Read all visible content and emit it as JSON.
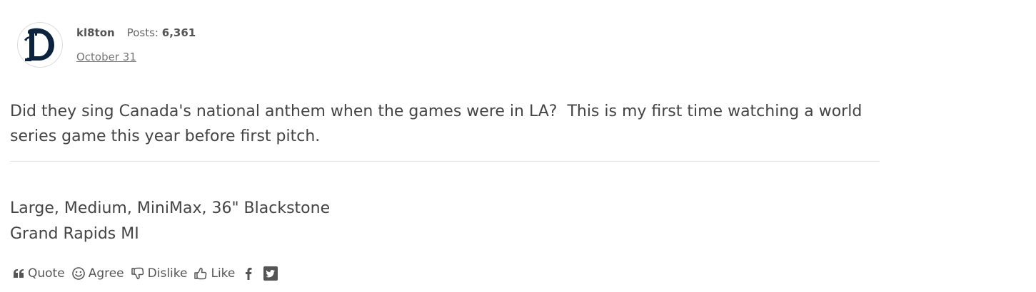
{
  "post": {
    "author": {
      "username": "kl8ton",
      "posts_label": "Posts:",
      "posts_count": "6,361",
      "avatar_icon": "detroit-tigers-d-icon"
    },
    "date": "October 31",
    "message": "Did they sing Canada's national anthem when the games were in LA?  This is my first time watching a world series game this year before first pitch.",
    "signature": {
      "line1": "Large, Medium, MiniMax, 36\" Blackstone",
      "line2": "Grand Rapids MI"
    },
    "reactions": [
      {
        "label": "Quote",
        "icon": "quote-icon"
      },
      {
        "label": "Agree",
        "icon": "smile-icon"
      },
      {
        "label": "Dislike",
        "icon": "thumbs-down-icon"
      },
      {
        "label": "Like",
        "icon": "thumbs-up-icon"
      }
    ],
    "share": [
      {
        "icon": "facebook-icon"
      },
      {
        "icon": "twitter-icon"
      }
    ]
  },
  "colors": {
    "text": "#444444",
    "divider": "#e1e1e1",
    "avatar_navy": "#0c2340"
  }
}
